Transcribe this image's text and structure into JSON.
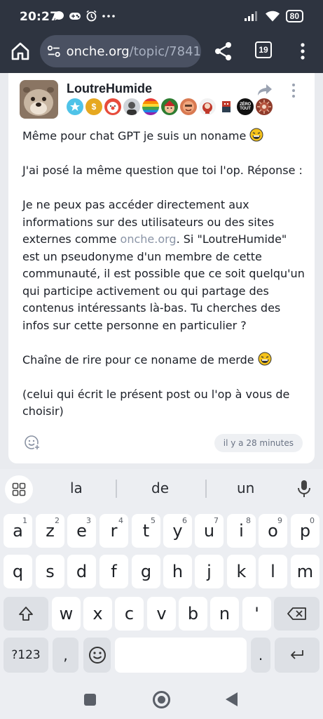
{
  "status_bar": {
    "time": "20:27",
    "battery": "80",
    "icons": [
      "chat-bubble-icon",
      "gamepad-icon",
      "alarm-icon",
      "more-dots-icon",
      "signal-icon",
      "wifi-icon",
      "battery-icon"
    ]
  },
  "browser": {
    "url_domain": "onche.org",
    "url_path": "/topic/7841",
    "tab_count": "19"
  },
  "post": {
    "author": "LoutreHumide",
    "badges": [
      "star-badge",
      "dollar-badge",
      "clown-badge",
      "portrait-badge",
      "rainbow-badge",
      "elf-badge",
      "face-badge",
      "bear-badge",
      "pixel-badge",
      "zero-tout-badge",
      "virus-badge"
    ],
    "zero_tout_label": "ZÉRO TOUT",
    "paragraph_1": "Même pour chat GPT je suis un noname",
    "paragraph_2": "J'ai posé la même question que toi l'op. Réponse :",
    "paragraph_3_a": "Je ne peux pas accéder directement aux informations sur des utilisateurs ou des sites externes comme ",
    "paragraph_3_link": "onche.org",
    "paragraph_3_b": ". Si \"LoutreHumide\" est un pseudonyme d'un membre de cette communauté, il est possible que ce soit quelqu'un qui participe activement ou qui partage des contenus intéressants là-bas. Tu cherches des infos sur cette personne en particulier ?",
    "paragraph_4": "Chaîne de rire pour ce noname de merde",
    "paragraph_5": "(celui qui écrit le présent post ou l'op à vous de choisir)",
    "timestamp": "il y a 28 minutes"
  },
  "keyboard": {
    "suggestions": [
      "la",
      "de",
      "un"
    ],
    "row1": [
      {
        "label": "a",
        "hint": "1"
      },
      {
        "label": "z",
        "hint": "2"
      },
      {
        "label": "e",
        "hint": "3"
      },
      {
        "label": "r",
        "hint": "4"
      },
      {
        "label": "t",
        "hint": "5"
      },
      {
        "label": "y",
        "hint": "6"
      },
      {
        "label": "u",
        "hint": "7"
      },
      {
        "label": "i",
        "hint": "8"
      },
      {
        "label": "o",
        "hint": "9"
      },
      {
        "label": "p",
        "hint": "0"
      }
    ],
    "row2": [
      "q",
      "s",
      "d",
      "f",
      "g",
      "h",
      "j",
      "k",
      "l",
      "m"
    ],
    "row3": [
      "w",
      "x",
      "c",
      "v",
      "b",
      "n",
      "'"
    ],
    "symbols_label": "?123",
    "comma_label": ",",
    "period_label": "."
  }
}
